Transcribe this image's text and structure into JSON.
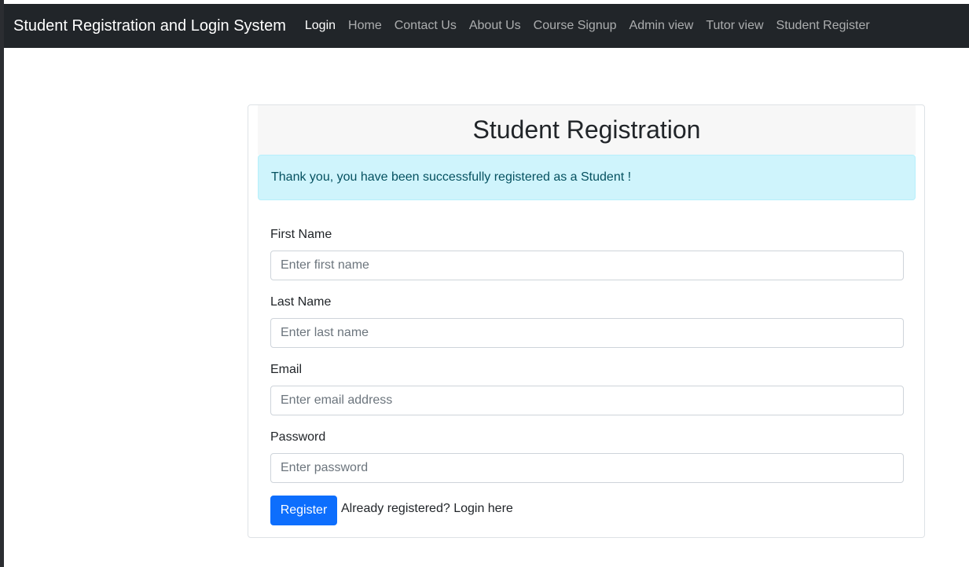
{
  "navbar": {
    "brand": "Student Registration and Login System",
    "links": [
      "Login",
      "Home",
      "Contact Us",
      "About Us",
      "Course Signup",
      "Admin view",
      "Tutor view",
      "Student Register"
    ],
    "active_link": "Login"
  },
  "form": {
    "title": "Student Registration",
    "alert": "Thank you, you have been successfully registered as a Student !",
    "first_name": {
      "label": "First Name",
      "placeholder": "Enter first name",
      "value": ""
    },
    "last_name": {
      "label": "Last Name",
      "placeholder": "Enter last name",
      "value": ""
    },
    "email": {
      "label": "Email",
      "placeholder": "Enter email address",
      "value": ""
    },
    "password": {
      "label": "Password",
      "placeholder": "Enter password",
      "value": ""
    },
    "register_button": "Register",
    "login_prompt": "Already registered? Login here"
  },
  "colors": {
    "navbar_bg": "#212529",
    "alert_bg": "#cff4fc",
    "alert_text": "#055160",
    "primary": "#0d6efd"
  }
}
